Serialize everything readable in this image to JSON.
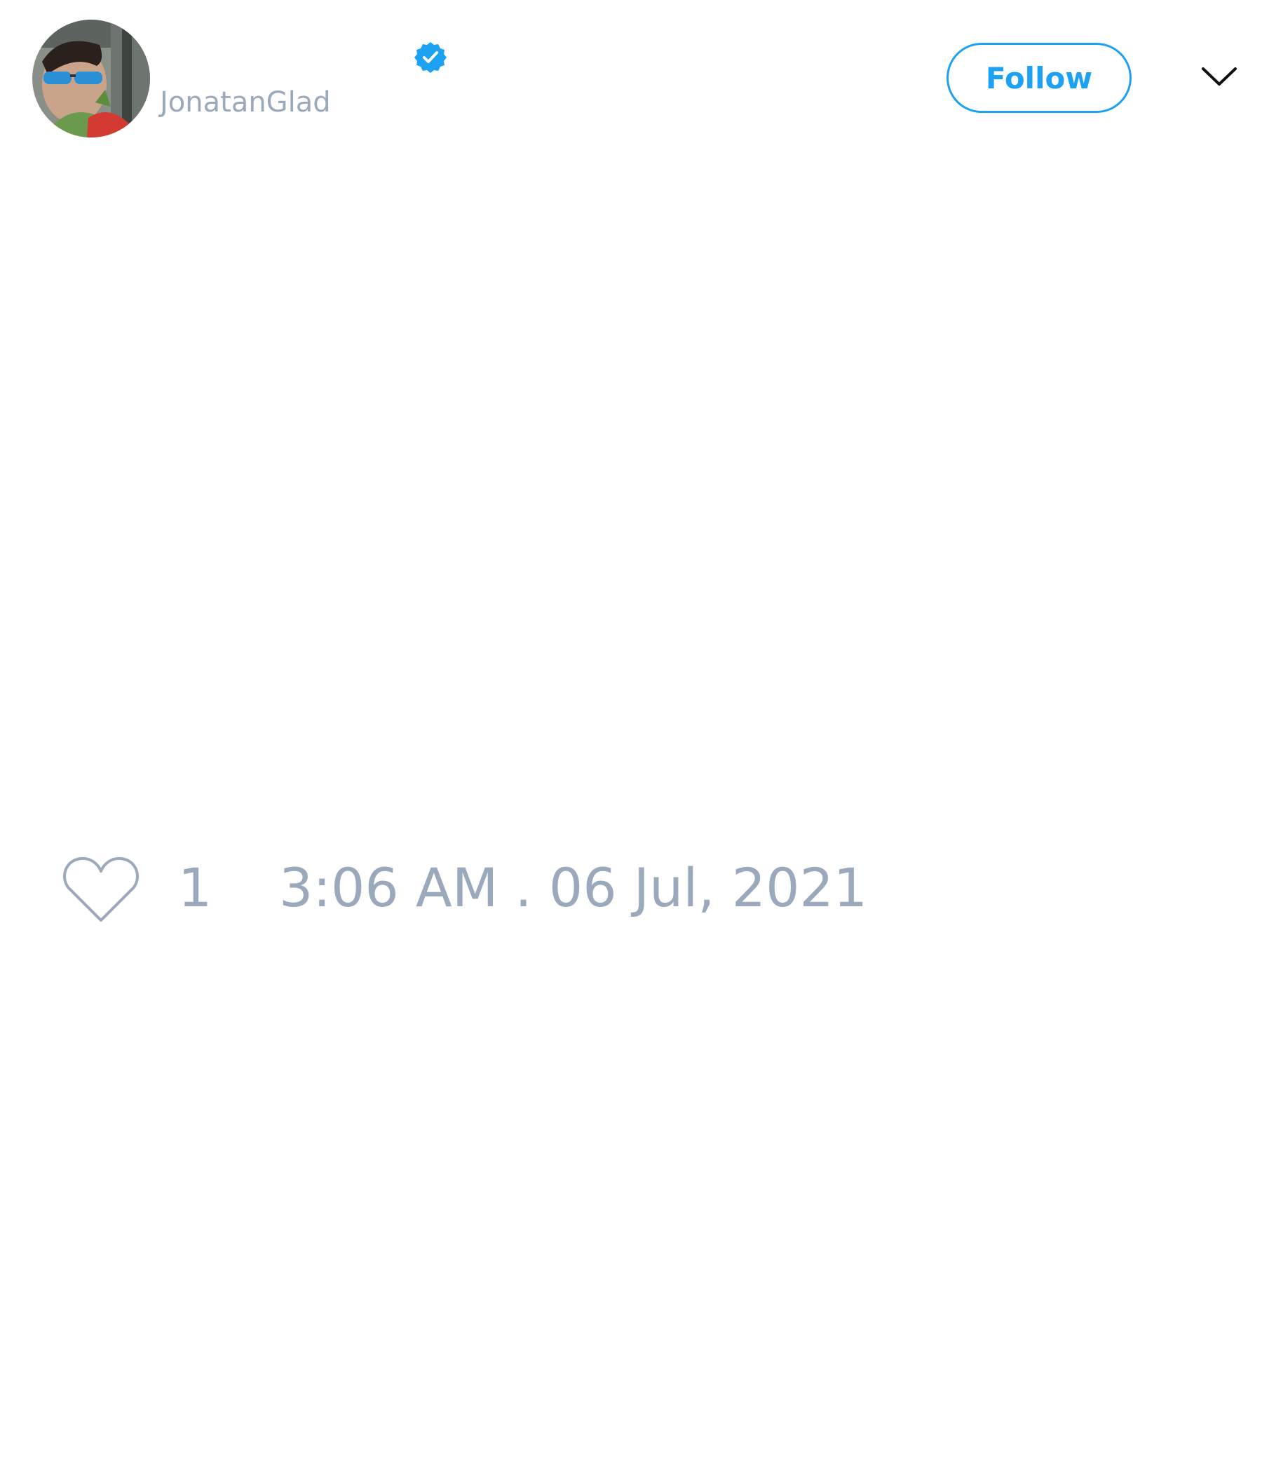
{
  "tweet": {
    "author": {
      "username": "JonatanGlad",
      "verified": true
    },
    "follow_label": "Follow",
    "likes": "1",
    "timestamp": "3:06 AM . 06 Jul, 2021"
  },
  "colors": {
    "accent": "#1da1f2",
    "muted_text": "#9aa9bb",
    "background": "#ffffff"
  },
  "icons": {
    "verified": "verified-badge-icon",
    "more": "chevron-down-icon",
    "like": "heart-icon"
  }
}
